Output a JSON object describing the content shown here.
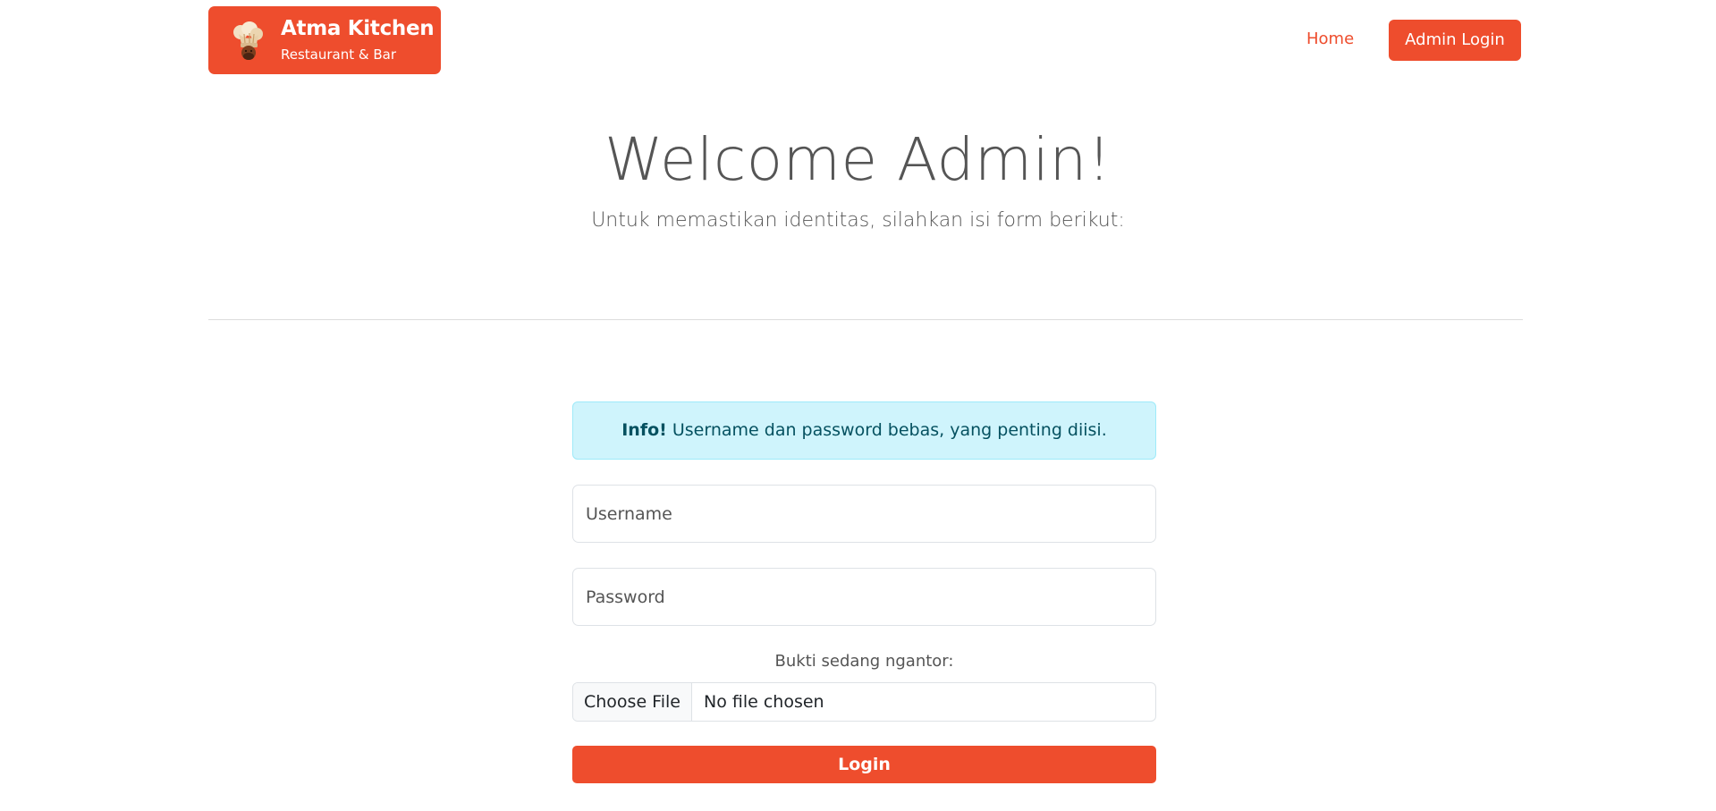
{
  "colors": {
    "accent": "#ee4d2d",
    "alert_bg": "#cff4fc",
    "alert_text": "#055160",
    "text": "#555555"
  },
  "navbar": {
    "brand": {
      "icon": "chef-hat-icon",
      "title": "Atma Kitchen",
      "subtitle": "Restaurant & Bar"
    },
    "links": {
      "home": "Home",
      "admin_login": "Admin Login"
    }
  },
  "hero": {
    "title": "Welcome Admin!",
    "subtitle": "Untuk memastikan identitas, silahkan isi form berikut:"
  },
  "form": {
    "alert": {
      "strong": "Info!",
      "text": " Username dan password bebas, yang penting diisi."
    },
    "username": {
      "value": "",
      "placeholder": "Username"
    },
    "password": {
      "value": "",
      "placeholder": "Password"
    },
    "file": {
      "label": "Bukti sedang ngantor:",
      "button": "Choose File",
      "status": "No file chosen"
    },
    "submit": "Login"
  }
}
